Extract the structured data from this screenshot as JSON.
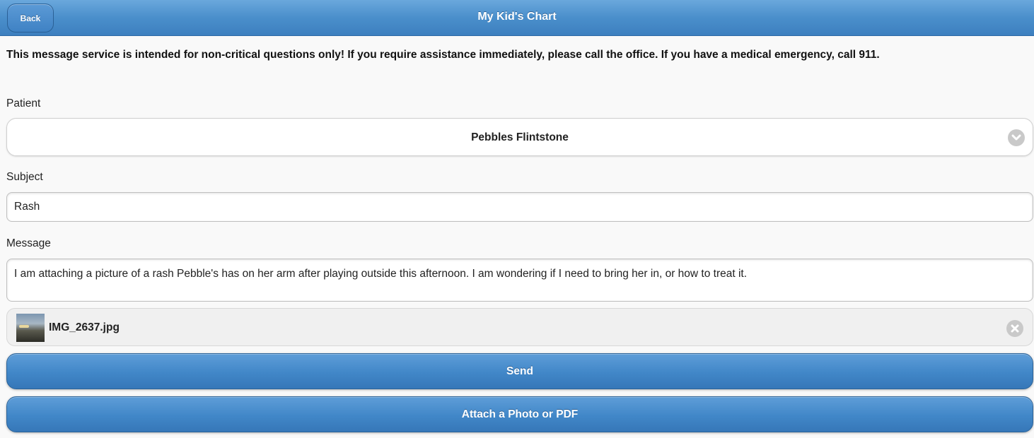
{
  "header": {
    "title": "My Kid's Chart",
    "back_label": "Back"
  },
  "notice": "This message service is intended for non-critical questions only! If you require assistance immediately, please call the office. If you have a medical emergency, call 911.",
  "patient": {
    "label": "Patient",
    "selected": "Pebbles Flintstone",
    "icon": "chevron-down-icon"
  },
  "subject": {
    "label": "Subject",
    "value": "Rash"
  },
  "message": {
    "label": "Message",
    "value": "I am attaching a picture of a rash Pebble's has on her arm after playing outside this afternoon. I am wondering if I need to bring her in, or how to treat it."
  },
  "attachment": {
    "file_name": "IMG_2637.jpg",
    "remove_icon": "close-icon"
  },
  "buttons": {
    "send": "Send",
    "attach": "Attach a Photo or PDF"
  },
  "colors": {
    "accent": "#4a8fcb",
    "background": "#f9f9f9"
  }
}
